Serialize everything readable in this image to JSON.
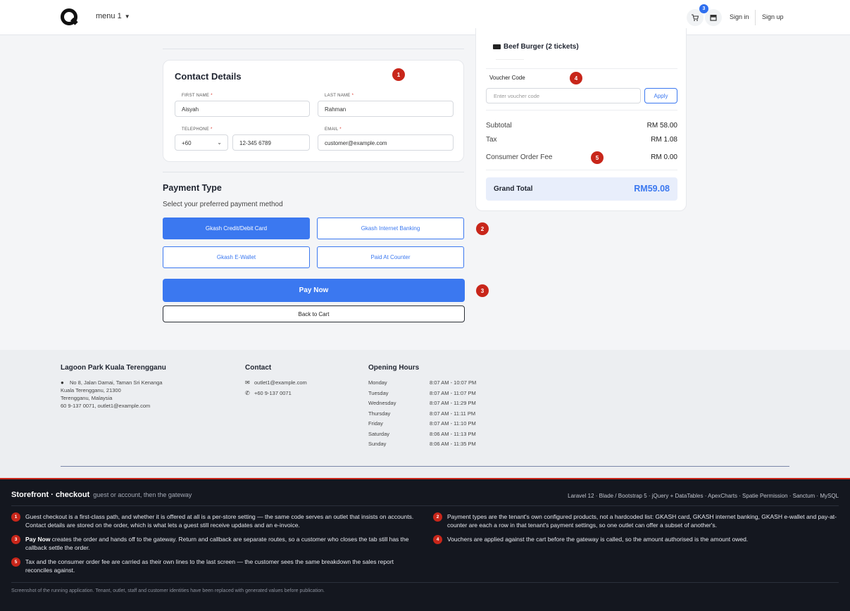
{
  "nav": {
    "menu_label": "menu 1",
    "cart_count": "3",
    "sign_in": "Sign in",
    "sign_up": "Sign up"
  },
  "contact": {
    "title": "Contact Details",
    "first_name_label": "FIRST NAME",
    "first_name_value": "Aisyah",
    "last_name_label": "LAST NAME",
    "last_name_value": "Rahman",
    "telephone_label": "TELEPHONE",
    "country_code": "+60",
    "phone_value": "12-345 6789",
    "email_label": "EMAIL",
    "email_value": "customer@example.com",
    "required_mark": "*"
  },
  "payment": {
    "title": "Payment Type",
    "subtitle": "Select your preferred payment method",
    "options": [
      {
        "label": "Gkash Credit/Debit Card",
        "selected": true
      },
      {
        "label": "Gkash Internet Banking",
        "selected": false
      },
      {
        "label": "Gkash E-Wallet",
        "selected": false
      },
      {
        "label": "Paid At Counter",
        "selected": false
      }
    ],
    "pay_now": "Pay Now",
    "back_to_cart": "Back to Cart"
  },
  "summary": {
    "item": "Beef Burger (2 tickets)",
    "voucher_label": "Voucher Code",
    "voucher_placeholder": "Enter voucher code",
    "apply": "Apply",
    "subtotal_label": "Subtotal",
    "subtotal_value": "RM 58.00",
    "tax_label": "Tax",
    "tax_value": "RM 1.08",
    "fee_label": "Consumer Order Fee",
    "fee_value": "RM 0.00",
    "grand_label": "Grand Total",
    "grand_value": "RM59.08"
  },
  "markers": [
    "1",
    "2",
    "3",
    "4",
    "5"
  ],
  "footer": {
    "store_name": "Lagoon Park Kuala Terengganu",
    "address_line1": "No 8, Jalan Damai, Taman Sri Kenanga",
    "address_line2": "Kuala Terengganu, 21300",
    "address_line3": "Terengganu, Malaysia",
    "address_line4": "60 9-137 0071, outlet1@example.com",
    "contact_title": "Contact",
    "contact_email": "outlet1@example.com",
    "contact_phone": "+60 9-137 0071",
    "hours_title": "Opening Hours",
    "hours": [
      {
        "day": "Monday",
        "time": "8:07 AM - 10:07 PM"
      },
      {
        "day": "Tuesday",
        "time": "8:07 AM - 11:07 PM"
      },
      {
        "day": "Wednesday",
        "time": "8:07 AM - 11:29 PM"
      },
      {
        "day": "Thursday",
        "time": "8:07 AM - 11:11 PM"
      },
      {
        "day": "Friday",
        "time": "8:07 AM - 11:10 PM"
      },
      {
        "day": "Saturday",
        "time": "8:06 AM - 11:13 PM"
      },
      {
        "day": "Sunday",
        "time": "8:06 AM - 11:35 PM"
      }
    ]
  },
  "annotation": {
    "title": "Storefront · checkout",
    "subtitle": "guest or account, then the gateway",
    "stack": "Laravel 12 · Blade / Bootstrap 5 · jQuery + DataTables · ApexCharts · Spatie Permission · Sanctum · MySQL",
    "notes": [
      {
        "n": "1",
        "bold": "",
        "text": "Guest checkout is a first-class path, and whether it is offered at all is a per-store setting — the same code serves an outlet that insists on accounts. Contact details are stored on the order, which is what lets a guest still receive updates and an e-invoice."
      },
      {
        "n": "2",
        "bold": "",
        "text": "Payment types are the tenant's own configured products, not a hardcoded list: GKASH card, GKASH internet banking, GKASH e-wallet and pay-at-counter are each a row in that tenant's payment settings, so one outlet can offer a subset of another's."
      },
      {
        "n": "3",
        "bold": "Pay Now",
        "text": " creates the order and hands off to the gateway. Return and callback are separate routes, so a customer who closes the tab still has the callback settle the order."
      },
      {
        "n": "4",
        "bold": "",
        "text": "Vouchers are applied against the cart before the gateway is called, so the amount authorised is the amount owed."
      },
      {
        "n": "5",
        "bold": "",
        "text": "Tax and the consumer order fee are carried as their own lines to the last screen — the customer sees the same breakdown the sales report reconciles against."
      }
    ],
    "footnote": "Screenshot of the running application. Tenant, outlet, staff and customer identities have been replaced with generated values before publication."
  },
  "colors": {
    "accent": "#3b78f0",
    "marker": "#c8261a",
    "dark_panel": "#14171f"
  }
}
